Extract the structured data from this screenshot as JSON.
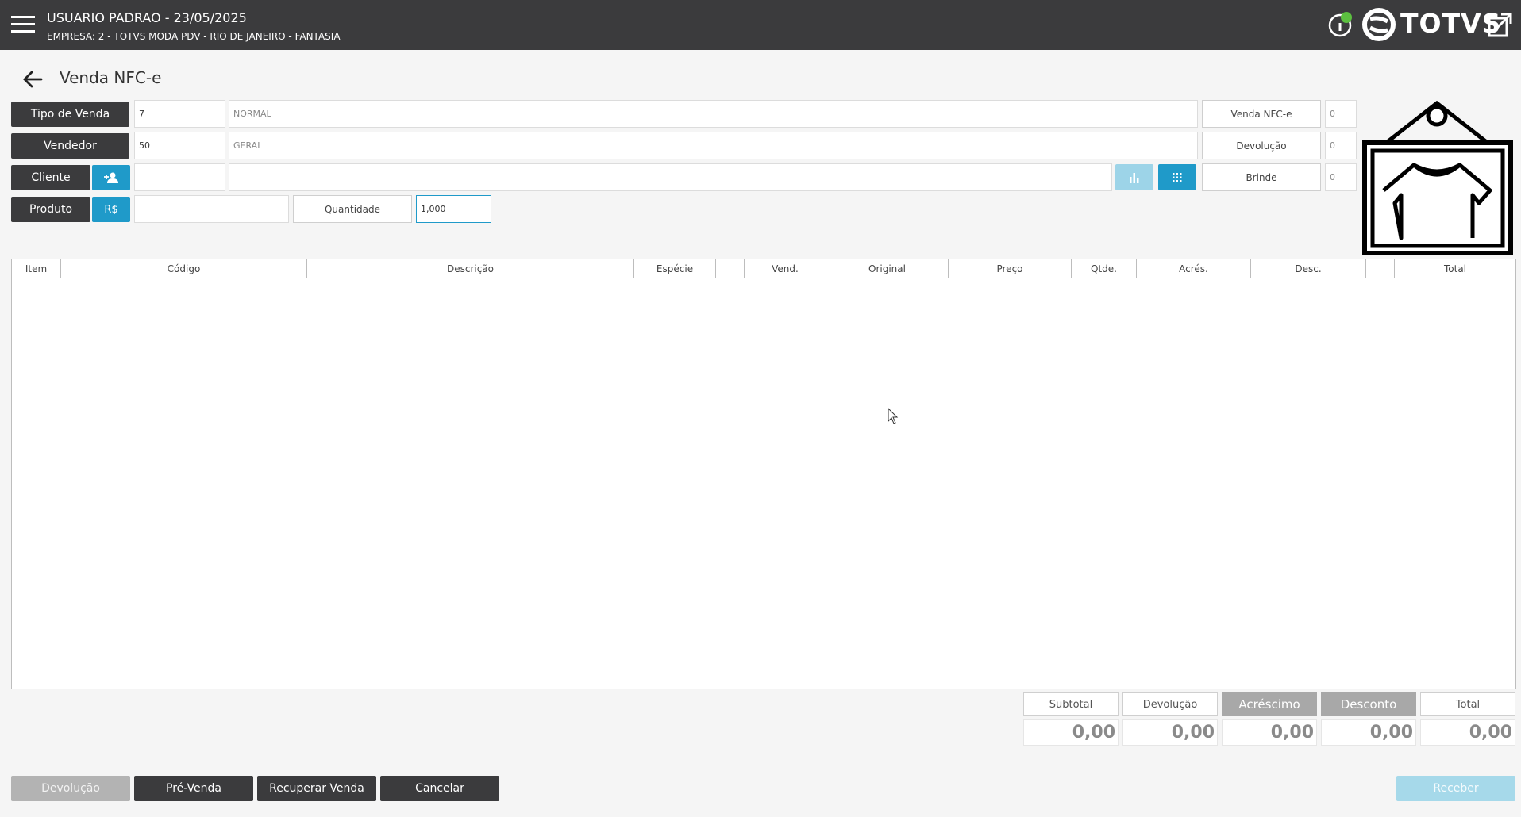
{
  "topbar": {
    "user_line": "USUARIO PADRAO - 23/05/2025",
    "company_line": "EMPRESA: 2 - TOTVS MODA PDV - RIO DE JANEIRO - FANTASIA",
    "brand": "TOTVS",
    "status_color": "#5cc040"
  },
  "header": {
    "title": "Venda NFC-e"
  },
  "form": {
    "tipo_venda": {
      "label": "Tipo de Venda",
      "code": "7",
      "desc": "NORMAL"
    },
    "vendedor": {
      "label": "Vendedor",
      "code": "50",
      "desc": "GERAL"
    },
    "cliente": {
      "label": "Cliente",
      "code": "",
      "desc": ""
    },
    "produto": {
      "label": "Produto",
      "price_btn": "R$",
      "code": "",
      "quantidade_label": "Quantidade",
      "quantidade_value": "1,000"
    }
  },
  "counters": [
    {
      "label": "Venda NFC-e",
      "value": "0"
    },
    {
      "label": "Devolução",
      "value": "0"
    },
    {
      "label": "Brinde",
      "value": "0"
    }
  ],
  "table": {
    "columns": [
      "Item",
      "Código",
      "Descrição",
      "Espécie",
      "",
      "Vend.",
      "Original",
      "Preço",
      "Qtde.",
      "Acrés.",
      "Desc.",
      "",
      "Total"
    ],
    "rows": []
  },
  "totals": [
    {
      "label": "Subtotal",
      "value": "0,00"
    },
    {
      "label": "Devolução",
      "value": "0,00"
    },
    {
      "label": "Acréscimo",
      "value": "0,00"
    },
    {
      "label": "Desconto",
      "value": "0,00"
    },
    {
      "label": "Total",
      "value": "0,00"
    }
  ],
  "buttons": {
    "devolucao": "Devolução",
    "pre_venda": "Pré-Venda",
    "recuperar": "Recuperar Venda",
    "cancelar": "Cancelar",
    "receber": "Receber"
  },
  "colors": {
    "dark": "#3b3b3d",
    "accent": "#1f9ac9",
    "accent_light": "#9dd4e8"
  }
}
